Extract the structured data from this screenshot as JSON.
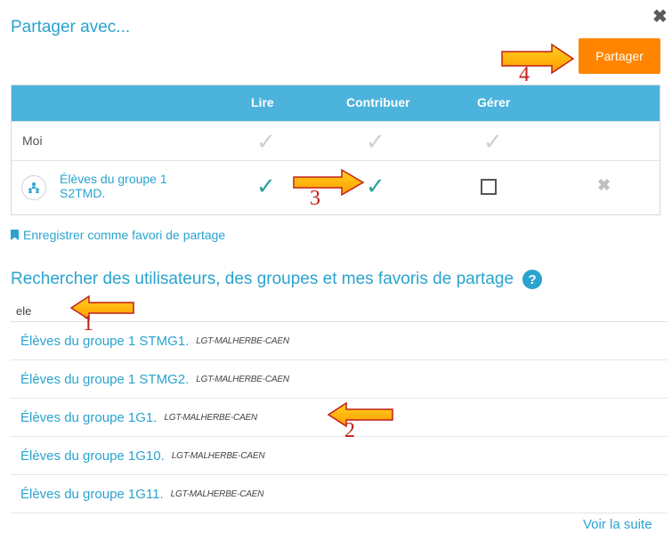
{
  "dialog": {
    "title": "Partager avec...",
    "share_button": "Partager"
  },
  "table": {
    "headers": [
      "Lire",
      "Contribuer",
      "Gérer"
    ],
    "me_row_label": "Moi",
    "group_row": {
      "name_line1": "Élèves du groupe 1",
      "name_line2": "S2TMD."
    }
  },
  "favorite_link": "Enregistrer comme favori de partage",
  "search": {
    "title": "Rechercher des utilisateurs, des groupes et mes favoris de partage",
    "help_glyph": "?",
    "value": "ele"
  },
  "results": [
    {
      "name": "Élèves du groupe 1 STMG1.",
      "school": "LGT-MALHERBE-CAEN"
    },
    {
      "name": "Élèves du groupe 1 STMG2.",
      "school": "LGT-MALHERBE-CAEN"
    },
    {
      "name": "Élèves du groupe 1G1.",
      "school": "LGT-MALHERBE-CAEN"
    },
    {
      "name": "Élèves du groupe 1G10.",
      "school": "LGT-MALHERBE-CAEN"
    },
    {
      "name": "Élèves du groupe 1G11.",
      "school": "LGT-MALHERBE-CAEN"
    }
  ],
  "more_link": "Voir la suite",
  "annotations": [
    "1",
    "2",
    "3",
    "4"
  ],
  "colors": {
    "accent": "#2aa3cf",
    "header": "#4bb3dc",
    "button": "#ff8500",
    "check": "#2aa39a",
    "annotation": "#c0201a"
  },
  "icons": [
    "close-icon",
    "checkmark-icon",
    "checkbox-icon",
    "group-icon",
    "remove-icon",
    "bookmark-icon",
    "help-icon",
    "arrow-icon"
  ]
}
